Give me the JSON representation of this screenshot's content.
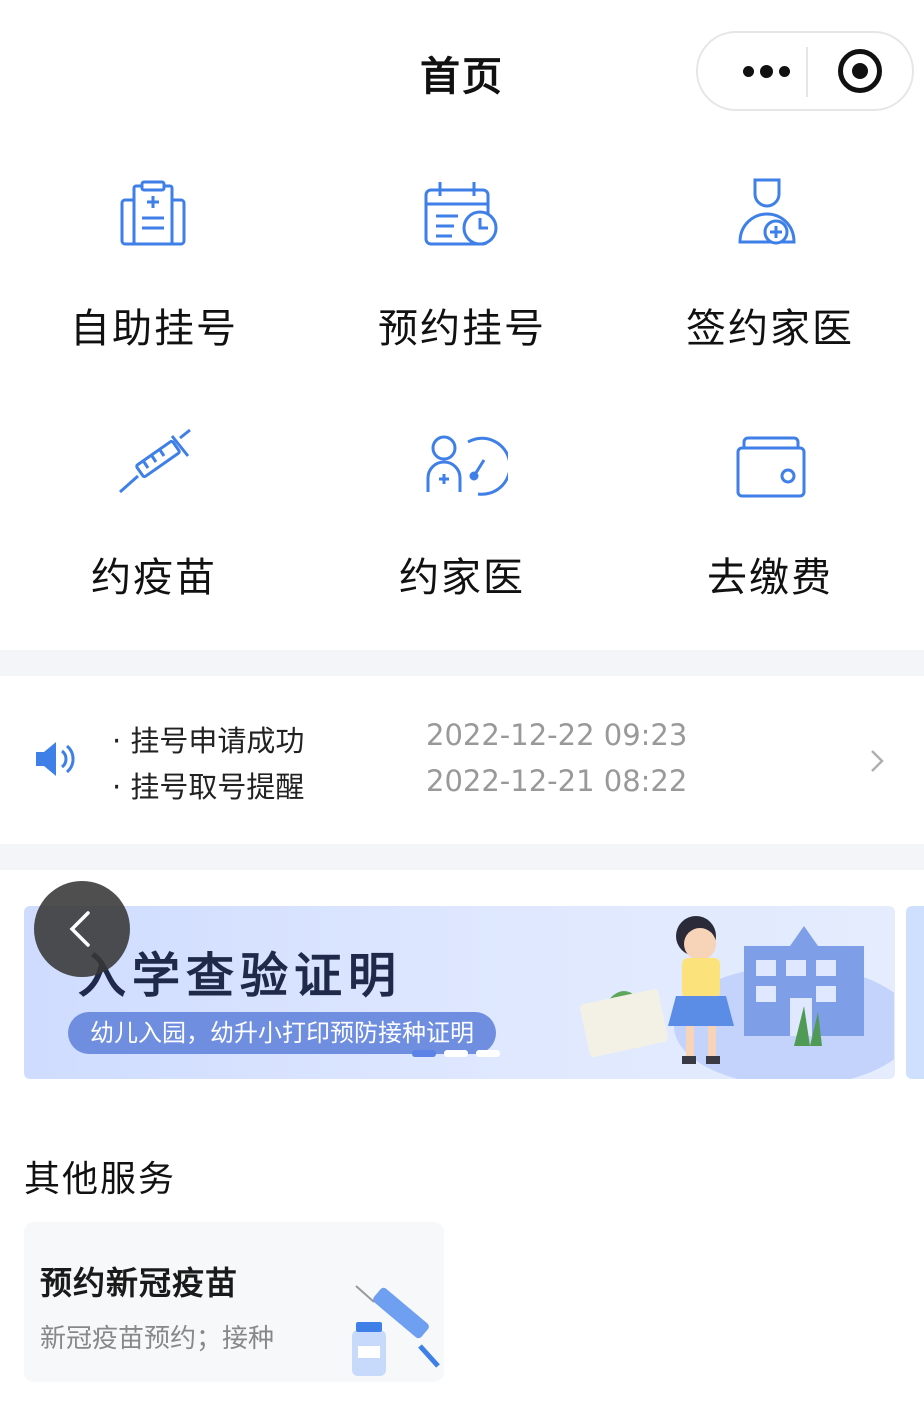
{
  "header": {
    "title": "首页"
  },
  "shortcuts": [
    {
      "label": "自助挂号",
      "icon": "registration-clipboard-icon"
    },
    {
      "label": "预约挂号",
      "icon": "calendar-clock-icon"
    },
    {
      "label": "签约家医",
      "icon": "doctor-plus-icon"
    },
    {
      "label": "约疫苗",
      "icon": "syringe-icon"
    },
    {
      "label": "约家医",
      "icon": "doctor-gauge-icon"
    },
    {
      "label": "去缴费",
      "icon": "wallet-icon"
    }
  ],
  "notices": [
    {
      "text": "· 挂号申请成功",
      "time": "2022-12-22 09:23"
    },
    {
      "text": "· 挂号取号提醒",
      "time": "2022-12-21 08:22"
    }
  ],
  "banner": {
    "title": "入学查验证明",
    "subtitle": "幼儿入园，幼升小打印预防接种证明",
    "slides": 3,
    "active_slide": 1
  },
  "other_services": {
    "title": "其他服务",
    "cards": [
      {
        "title": "预约新冠疫苗",
        "desc": "新冠疫苗预约；接种",
        "icon": "vaccine-vial-syringe-icon"
      }
    ]
  },
  "colors": {
    "accent": "#3f7fe8",
    "banner_bg": "#d8e4ff",
    "chip": "#6f8ee0"
  }
}
